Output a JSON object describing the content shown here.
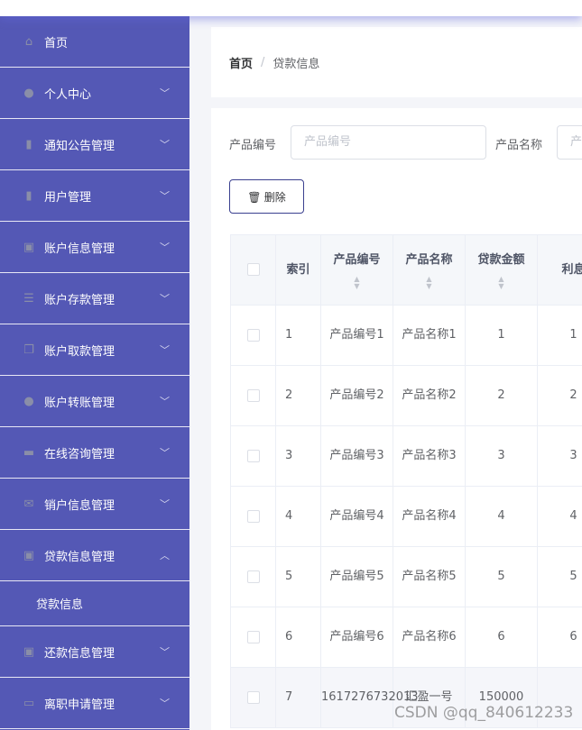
{
  "sidebar": {
    "items": [
      {
        "label": "首页",
        "icon": "home-icon",
        "chev": ""
      },
      {
        "label": "个人中心",
        "icon": "user-icon",
        "chev": "﹀"
      },
      {
        "label": "通知公告管理",
        "icon": "notice-icon",
        "chev": "﹀"
      },
      {
        "label": "用户管理",
        "icon": "chart-icon",
        "chev": "﹀"
      },
      {
        "label": "账户信息管理",
        "icon": "clipboard-icon",
        "chev": "﹀"
      },
      {
        "label": "账户存款管理",
        "icon": "sliders-icon",
        "chev": "﹀"
      },
      {
        "label": "账户取款管理",
        "icon": "copy-icon",
        "chev": "﹀"
      },
      {
        "label": "账户转账管理",
        "icon": "bulb-icon",
        "chev": "﹀"
      },
      {
        "label": "在线咨询管理",
        "icon": "briefcase-icon",
        "chev": "﹀"
      },
      {
        "label": "销户信息管理",
        "icon": "mail-icon",
        "chev": "﹀"
      },
      {
        "label": "贷款信息管理",
        "icon": "clipboard-check-icon",
        "chev": "︿"
      },
      {
        "label": "还款信息管理",
        "icon": "clipboard-icon",
        "chev": "﹀"
      },
      {
        "label": "离职申请管理",
        "icon": "card-icon",
        "chev": "﹀"
      }
    ],
    "submenu": "贷款信息"
  },
  "breadcrumb": {
    "home": "首页",
    "sep": "/",
    "current": "贷款信息"
  },
  "search": {
    "label1": "产品编号",
    "placeholder1": "产品编号",
    "label2": "产品名称",
    "placeholder2": "产"
  },
  "toolbar": {
    "delete_label": "🗑 删除"
  },
  "table": {
    "headers": [
      "索引",
      "产品编号",
      "产品名称",
      "贷款金额",
      "利息"
    ],
    "rows": [
      [
        "1",
        "产品编号1",
        "产品名称1",
        "1",
        "1"
      ],
      [
        "2",
        "产品编号2",
        "产品名称2",
        "2",
        "2"
      ],
      [
        "3",
        "产品编号3",
        "产品名称3",
        "3",
        "3"
      ],
      [
        "4",
        "产品编号4",
        "产品名称4",
        "4",
        "4"
      ],
      [
        "5",
        "产品编号5",
        "产品名称5",
        "5",
        "5"
      ],
      [
        "6",
        "产品编号6",
        "产品名称6",
        "6",
        "6"
      ],
      [
        "7",
        "1617276732013",
        "汇盈一号",
        "150000",
        ""
      ]
    ]
  },
  "watermark": "CSDN @qq_840612233"
}
